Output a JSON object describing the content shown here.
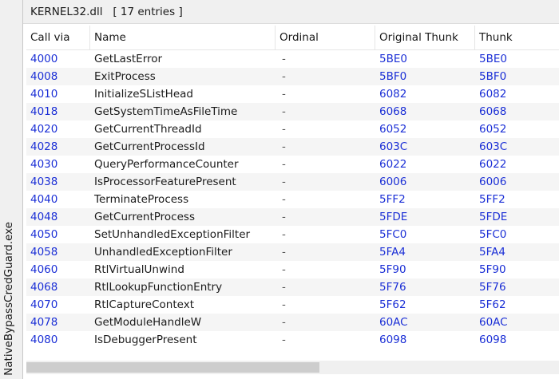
{
  "side_tab": {
    "label": "NativeBypassCredGuard.exe"
  },
  "panel": {
    "title": "KERNEL32.dll   [ 17 entries ]"
  },
  "table": {
    "columns": [
      "Call via",
      "Name",
      "Ordinal",
      "Original Thunk",
      "Thunk"
    ],
    "rows": [
      {
        "call_via": "4000",
        "name": "GetLastError",
        "ordinal": "-",
        "original_thunk": "5BE0",
        "thunk": "5BE0"
      },
      {
        "call_via": "4008",
        "name": "ExitProcess",
        "ordinal": "-",
        "original_thunk": "5BF0",
        "thunk": "5BF0"
      },
      {
        "call_via": "4010",
        "name": "InitializeSListHead",
        "ordinal": "-",
        "original_thunk": "6082",
        "thunk": "6082"
      },
      {
        "call_via": "4018",
        "name": "GetSystemTimeAsFileTime",
        "ordinal": "-",
        "original_thunk": "6068",
        "thunk": "6068"
      },
      {
        "call_via": "4020",
        "name": "GetCurrentThreadId",
        "ordinal": "-",
        "original_thunk": "6052",
        "thunk": "6052"
      },
      {
        "call_via": "4028",
        "name": "GetCurrentProcessId",
        "ordinal": "-",
        "original_thunk": "603C",
        "thunk": "603C"
      },
      {
        "call_via": "4030",
        "name": "QueryPerformanceCounter",
        "ordinal": "-",
        "original_thunk": "6022",
        "thunk": "6022"
      },
      {
        "call_via": "4038",
        "name": "IsProcessorFeaturePresent",
        "ordinal": "-",
        "original_thunk": "6006",
        "thunk": "6006"
      },
      {
        "call_via": "4040",
        "name": "TerminateProcess",
        "ordinal": "-",
        "original_thunk": "5FF2",
        "thunk": "5FF2"
      },
      {
        "call_via": "4048",
        "name": "GetCurrentProcess",
        "ordinal": "-",
        "original_thunk": "5FDE",
        "thunk": "5FDE"
      },
      {
        "call_via": "4050",
        "name": "SetUnhandledExceptionFilter",
        "ordinal": "-",
        "original_thunk": "5FC0",
        "thunk": "5FC0"
      },
      {
        "call_via": "4058",
        "name": "UnhandledExceptionFilter",
        "ordinal": "-",
        "original_thunk": "5FA4",
        "thunk": "5FA4"
      },
      {
        "call_via": "4060",
        "name": "RtlVirtualUnwind",
        "ordinal": "-",
        "original_thunk": "5F90",
        "thunk": "5F90"
      },
      {
        "call_via": "4068",
        "name": "RtlLookupFunctionEntry",
        "ordinal": "-",
        "original_thunk": "5F76",
        "thunk": "5F76"
      },
      {
        "call_via": "4070",
        "name": "RtlCaptureContext",
        "ordinal": "-",
        "original_thunk": "5F62",
        "thunk": "5F62"
      },
      {
        "call_via": "4078",
        "name": "GetModuleHandleW",
        "ordinal": "-",
        "original_thunk": "60AC",
        "thunk": "60AC"
      },
      {
        "call_via": "4080",
        "name": "IsDebuggerPresent",
        "ordinal": "-",
        "original_thunk": "6098",
        "thunk": "6098"
      }
    ]
  },
  "colors": {
    "address_text": "#1b2fd6",
    "alt_row_bg": "#f5f5f5",
    "header_bg": "#f0f0f0"
  },
  "scrollbar": {
    "horizontal_visible_fraction": 0.55
  }
}
